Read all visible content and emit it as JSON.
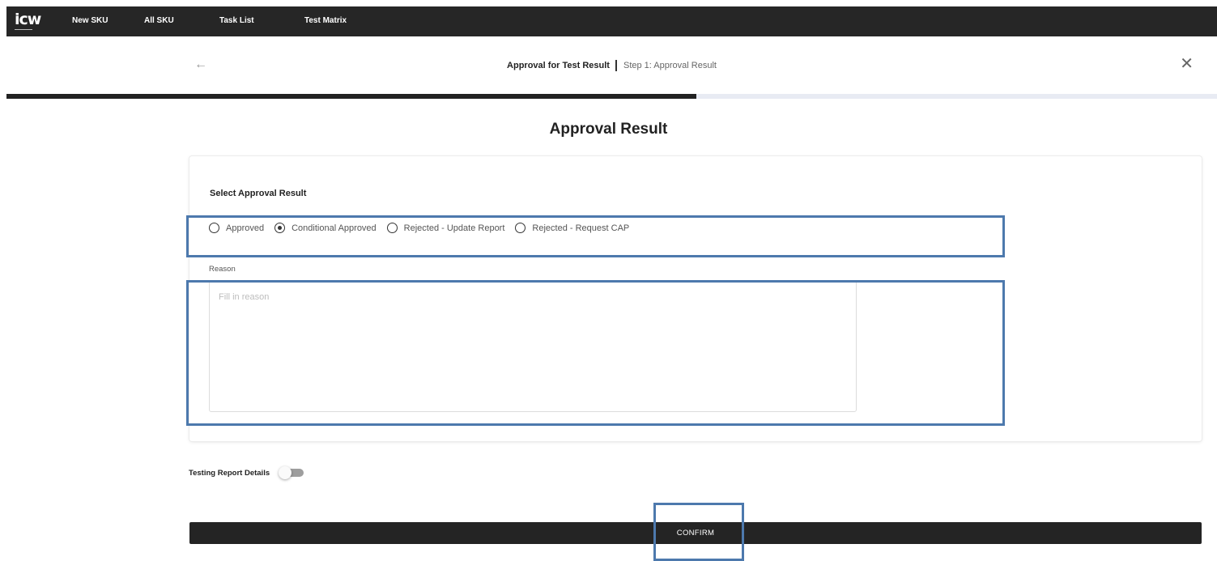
{
  "nav": {
    "logo": "icw",
    "items": [
      {
        "label": "New SKU"
      },
      {
        "label": "All SKU"
      },
      {
        "label": "Task List"
      },
      {
        "label": "Test Matrix"
      }
    ]
  },
  "header": {
    "back_icon": "arrow-left-icon",
    "title": "Approval for Test Result",
    "subtitle": "Step 1: Approval Result",
    "close_icon": "close-icon"
  },
  "progress": {
    "percent": 57
  },
  "page": {
    "title": "Approval Result"
  },
  "form": {
    "section_label": "Select Approval Result",
    "options": [
      {
        "label": "Approved",
        "checked": false
      },
      {
        "label": "Conditional Approved",
        "checked": true
      },
      {
        "label": "Rejected - Update Report",
        "checked": false
      },
      {
        "label": "Rejected - Request CAP",
        "checked": false
      }
    ],
    "reason_label": "Reason",
    "reason_value": "",
    "reason_placeholder": "Fill in reason"
  },
  "toggle": {
    "label": "Testing Report Details",
    "on": false
  },
  "confirm_label": "CONFIRM",
  "colors": {
    "nav_bg": "#262626",
    "progress_fill": "#222222",
    "progress_track": "#e8ebf3",
    "button_bg": "#242424",
    "highlight": "#4d79ad"
  }
}
